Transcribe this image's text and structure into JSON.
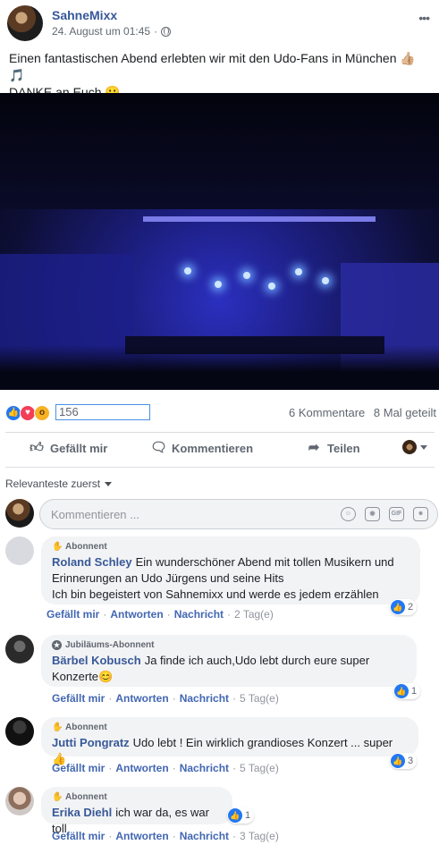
{
  "post": {
    "page_name": "SahneMixx",
    "date": "24. August um 01:45",
    "separator": "·",
    "text_line1": "Einen fantastischen Abend erlebten wir mit den Udo-Fans in München 👍🏼🎵",
    "text_line2": "DANKE an Euch 😀",
    "more": "•••"
  },
  "reactions": {
    "icons": [
      "like-icon",
      "love-icon",
      "wow-icon"
    ],
    "count": "156",
    "comments": "6 Kommentare",
    "shares": "8 Mal geteilt"
  },
  "actions": {
    "like": "Gefällt mir",
    "comment": "Kommentieren",
    "share": "Teilen"
  },
  "sort": {
    "label": "Relevanteste zuerst"
  },
  "composer": {
    "placeholder": "Kommentieren ...",
    "tools": [
      "emoji-icon",
      "camera-icon",
      "gif-icon",
      "sticker-icon"
    ],
    "gif_label": "GIF"
  },
  "footer_labels": {
    "like": "Gefällt mir",
    "reply": "Antworten",
    "report": "Nachricht",
    "dot": "·"
  },
  "comments": [
    {
      "badge": "Abonnent",
      "name": "Roland Schley",
      "text": "Ein wunderschöner Abend mit tollen Musikern und Erinnerungen an Udo Jürgens und seine Hits",
      "text2": "Ich bin begeistert von Sahnemixx und werde es jedem erzählen",
      "time": "2 Tag(e)",
      "likes": "2"
    },
    {
      "badge": "Jubiläums-Abonnent",
      "name": "Bärbel Kobusch",
      "text": "Ja finde ich auch,Udo lebt durch eure super",
      "text2": "Konzerte😊",
      "time": "5 Tag(e)",
      "likes": "1"
    },
    {
      "badge": "Abonnent",
      "name": "Jutti Pongratz",
      "text": "Udo lebt ! Ein wirklich grandioses Konzert ... super 👍",
      "time": "5 Tag(e)",
      "likes": "3"
    },
    {
      "badge": "Abonnent",
      "name": "Erika Diehl",
      "text": "ich war da, es war toll",
      "time": "3 Tag(e)",
      "likes": "1"
    }
  ],
  "colors": {
    "link": "#385898",
    "like_blue": "#2078f4",
    "love_red": "#f33e58",
    "wow_yellow": "#f7b125"
  }
}
